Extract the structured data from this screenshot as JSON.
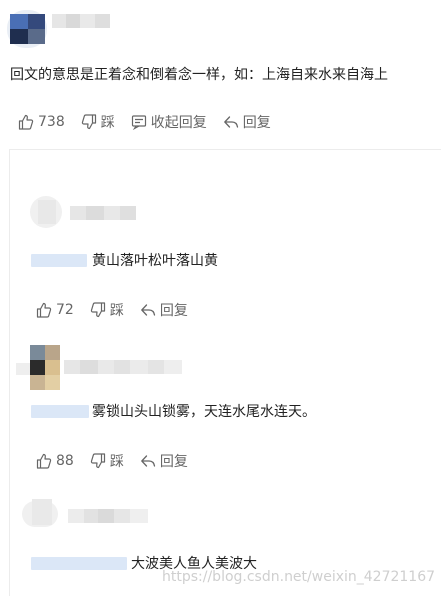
{
  "top_comment": {
    "text": "回文的意思是正着念和倒着念一样，如：上海自来水来自海上",
    "likes": "738",
    "dislike_label": "踩",
    "collapse_label": "收起回复",
    "reply_label": "回复"
  },
  "replies": [
    {
      "text": "黄山落叶松叶落山黄",
      "likes": "72",
      "dislike_label": "踩",
      "reply_label": "回复"
    },
    {
      "text": "雾锁山头山锁雾，天连水尾水连天。",
      "likes": "88",
      "dislike_label": "踩",
      "reply_label": "回复"
    },
    {
      "text": "大波美人鱼人美波大"
    }
  ],
  "watermark": "https://blog.csdn.net/weixin_42721167",
  "icons": [
    "thumbs-up-icon",
    "thumbs-down-icon",
    "comment-icon",
    "reply-icon"
  ],
  "colors": {
    "text": "#222222",
    "muted": "#666666",
    "ref_bar": "#dbe7f7",
    "panel_border": "#ececec"
  }
}
